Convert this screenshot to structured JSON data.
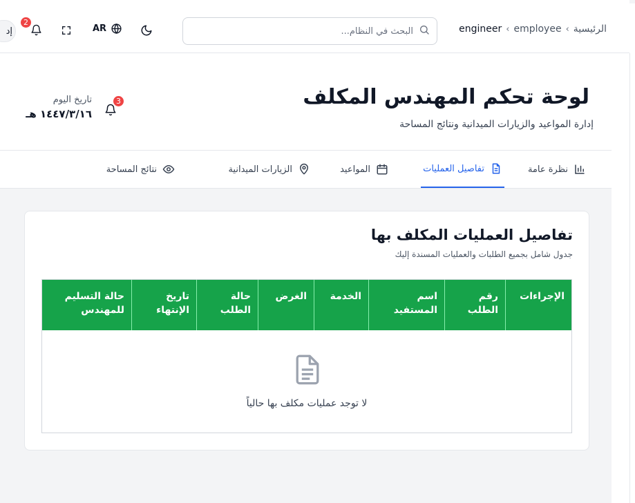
{
  "topbar": {
    "breadcrumb": [
      {
        "label": "الرئيسية"
      },
      {
        "label": "employee"
      },
      {
        "label": "engineer"
      }
    ],
    "search_placeholder": "البحث في النظام...",
    "lang_label": "AR",
    "notification_count": "2",
    "user_initial": "إد"
  },
  "header": {
    "title": "لوحة تحكم المهندس المكلف",
    "subtitle": "إدارة المواعيد والزيارات الميدانية ونتائج المساحة",
    "date_label": "تاريخ اليوم",
    "date_value": "١٤٤٧/٣/١٦ هـ",
    "notification_count": "3"
  },
  "tabs": [
    {
      "label": "نظرة عامة",
      "icon": "bar-chart-icon",
      "active": false
    },
    {
      "label": "تفاصيل العمليات",
      "icon": "document-icon",
      "active": true
    },
    {
      "label": "المواعيد",
      "icon": "calendar-icon",
      "active": false
    },
    {
      "label": "الزيارات الميدانية",
      "icon": "map-pin-icon",
      "active": false
    },
    {
      "label": "نتائج المساحة",
      "icon": "eye-icon",
      "active": false
    }
  ],
  "card": {
    "title": "تفاصيل العمليات المكلف بها",
    "subtitle": "جدول شامل بجميع الطلبات والعمليات المسندة إليك",
    "columns": [
      {
        "label": "الإجراءات"
      },
      {
        "label": "رقم الطلب"
      },
      {
        "label": "اسم المستفيد"
      },
      {
        "label": "الخدمة"
      },
      {
        "label": "الغرض"
      },
      {
        "label": "حالة الطلب"
      },
      {
        "label": "تاريخ الإنتهاء"
      },
      {
        "label": "حالة التسليم للمهندس"
      }
    ],
    "empty_text": "لا توجد عمليات مكلف بها حالياً"
  },
  "colors": {
    "accent": "#2563eb",
    "table_header": "#16a34a",
    "badge": "#ef4444"
  }
}
